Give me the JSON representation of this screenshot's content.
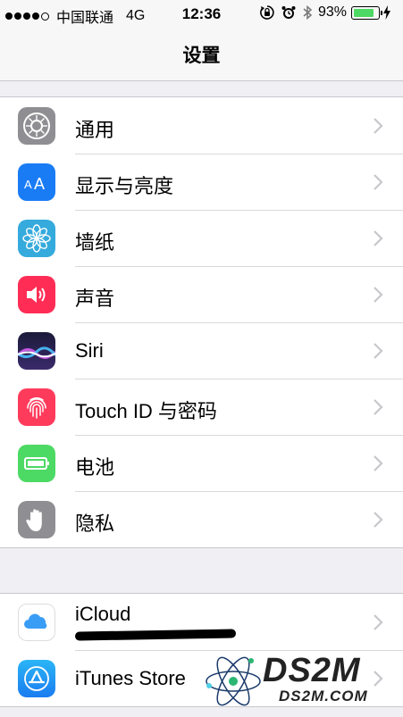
{
  "status_bar": {
    "carrier": "中国联通",
    "network": "4G",
    "time": "12:36",
    "battery_percent": "93%",
    "battery_level": 0.93
  },
  "nav": {
    "title": "设置"
  },
  "group1": [
    {
      "label": "通用",
      "icon": "gear-icon"
    },
    {
      "label": "显示与亮度",
      "icon": "display-brightness-icon"
    },
    {
      "label": "墙纸",
      "icon": "wallpaper-flower-icon"
    },
    {
      "label": "声音",
      "icon": "speaker-icon"
    },
    {
      "label": "Siri",
      "icon": "siri-icon"
    },
    {
      "label": "Touch ID 与密码",
      "icon": "fingerprint-icon"
    },
    {
      "label": "电池",
      "icon": "battery-icon"
    },
    {
      "label": "隐私",
      "icon": "hand-icon"
    }
  ],
  "group2": [
    {
      "label": "iCloud",
      "icon": "cloud-icon"
    },
    {
      "label": "iTunes Store",
      "icon": "app-store-icon"
    }
  ],
  "watermark": {
    "brand": "DS2M",
    "url": "DS2M.COM"
  },
  "colors": {
    "general": "#8e8e93",
    "display": "#1a7cf5",
    "wallpaper": "#35aadc",
    "sounds": "#ff2d55",
    "touchid": "#ff3b5c",
    "battery": "#4cd964",
    "privacy": "#8e8e93",
    "icloud": "#3a9df5",
    "appstore": "#1a8cf0"
  }
}
